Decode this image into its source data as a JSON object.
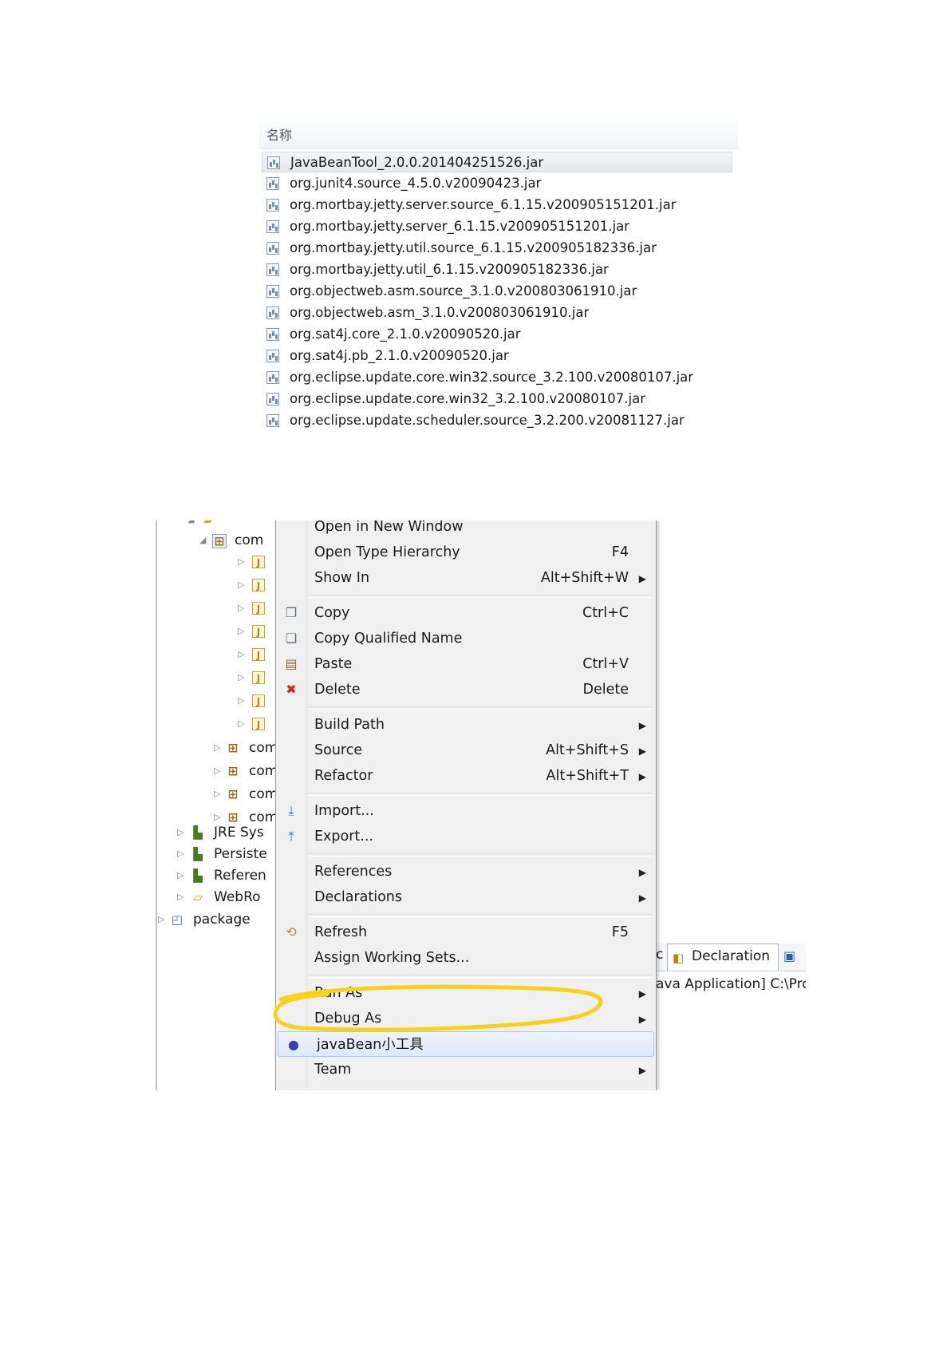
{
  "file_list": {
    "header": "名称",
    "files": [
      "JavaBeanTool_2.0.0.201404251526.jar",
      "org.junit4.source_4.5.0.v20090423.jar",
      "org.mortbay.jetty.server.source_6.1.15.v200905151201.jar",
      "org.mortbay.jetty.server_6.1.15.v200905151201.jar",
      "org.mortbay.jetty.util.source_6.1.15.v200905182336.jar",
      "org.mortbay.jetty.util_6.1.15.v200905182336.jar",
      "org.objectweb.asm.source_3.1.0.v200803061910.jar",
      "org.objectweb.asm_3.1.0.v200803061910.jar",
      "org.sat4j.core_2.1.0.v20090520.jar",
      "org.sat4j.pb_2.1.0.v20090520.jar",
      "org.eclipse.update.core.win32.source_3.2.100.v20080107.jar",
      "org.eclipse.update.core.win32_3.2.100.v20080107.jar",
      "org.eclipse.update.scheduler.source_3.2.200.v20081127.jar"
    ]
  },
  "tree": {
    "package_row": "com",
    "libraries": [
      "JRE Sys",
      "Persiste",
      "Referen",
      "WebRo"
    ],
    "project": "package"
  },
  "context_menu": {
    "items": [
      {
        "label": "Open in New Window",
        "shortcut": "",
        "icon": ""
      },
      {
        "label": "Open Type Hierarchy",
        "shortcut": "F4",
        "icon": ""
      },
      {
        "label": "Show In",
        "shortcut": "Alt+Shift+W",
        "icon": ""
      },
      {
        "label": "Copy",
        "shortcut": "Ctrl+C",
        "icon": "copy-icon"
      },
      {
        "label": "Copy Qualified Name",
        "shortcut": "",
        "icon": "copy-qualified-name-icon"
      },
      {
        "label": "Paste",
        "shortcut": "Ctrl+V",
        "icon": "paste-icon"
      },
      {
        "label": "Delete",
        "shortcut": "Delete",
        "icon": "delete-icon"
      },
      {
        "label": "Build Path",
        "shortcut": "",
        "icon": ""
      },
      {
        "label": "Source",
        "shortcut": "Alt+Shift+S",
        "icon": ""
      },
      {
        "label": "Refactor",
        "shortcut": "Alt+Shift+T",
        "icon": ""
      },
      {
        "label": "Import...",
        "shortcut": "",
        "icon": "import-icon"
      },
      {
        "label": "Export...",
        "shortcut": "",
        "icon": "export-icon"
      },
      {
        "label": "References",
        "shortcut": "",
        "icon": ""
      },
      {
        "label": "Declarations",
        "shortcut": "",
        "icon": ""
      },
      {
        "label": "Refresh",
        "shortcut": "F5",
        "icon": "refresh-icon"
      },
      {
        "label": "Assign Working Sets...",
        "shortcut": "",
        "icon": ""
      },
      {
        "label": "Run As",
        "shortcut": "",
        "icon": ""
      },
      {
        "label": "Debug As",
        "shortcut": "",
        "icon": ""
      },
      {
        "label": "javaBean小工具",
        "shortcut": "",
        "icon": "plugin-icon"
      },
      {
        "label": "Team",
        "shortcut": "",
        "icon": ""
      }
    ]
  },
  "bottom_tabs": {
    "partial_tab": "c",
    "declaration_tab": "Declaration",
    "console_line": "ava Application] C:\\Pro"
  },
  "colors": {
    "highlight_mark": "#f6d21a",
    "delete_icon": "#d62020"
  }
}
